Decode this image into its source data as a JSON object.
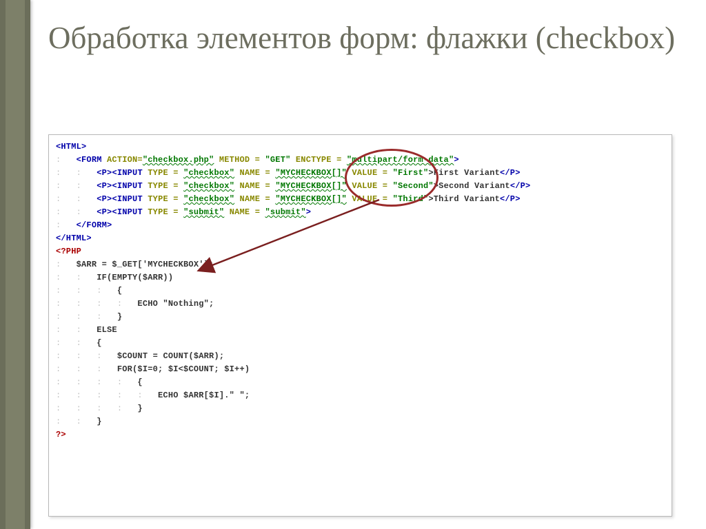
{
  "title": "Обработка элементов форм: флажки (checkbox)",
  "code": {
    "l1a": "<HTML>",
    "l2_open": "<FORM",
    "l2_attr": " ACTION=",
    "l2_v1": "\"checkbox.php\"",
    "l2_a2": " METHOD = ",
    "l2_v2": "\"GET\"",
    "l2_a3": " ENCTYPE = ",
    "l2_v3": "\"multipart/form-data\"",
    "l2_close": ">",
    "p_open": "<P>",
    "inp_open": "<INPUT",
    "type_a": " TYPE = ",
    "type_cb": "\"checkbox\"",
    "name_a": " NAME = ",
    "name_v": "\"MYCHECKBOX[]\"",
    "val_a": " VALUE = ",
    "val1": "\"First\"",
    "val2": "\"Second\"",
    "val3": "\"Third\"",
    "txt1": ">First Variant",
    "txt2": ">Second Variant",
    "txt3": ">Third Variant",
    "p_close": "</P>",
    "type_sub": "\"submit\"",
    "name_sub": "\"submit\"",
    "form_close": "</FORM>",
    "html_close": "</HTML>",
    "php_open": "<?PHP",
    "php1": "$ARR = $_GET['MYCHECKBOX'];",
    "php2": "IF(EMPTY($ARR))",
    "php3": "{",
    "php4": "ECHO \"Nothing\";",
    "php5": "}",
    "php6": "ELSE",
    "php7": "{",
    "php8": "$COUNT = COUNT($ARR);",
    "php9": "FOR($I=0; $I<$COUNT; $I++)",
    "php10": "{",
    "php11": "ECHO $ARR[$I].\" \";",
    "php12": "}",
    "php13": "}",
    "php_close": "?>"
  },
  "indent": {
    "i1": "    ",
    "i2": "        ",
    "i3": "            ",
    "i4": "                ",
    "i5": "                    ",
    "i6": "                        "
  },
  "guide": {
    "d1": ":   ",
    "d2": ":   :   ",
    "d3": ":   :   :   ",
    "d4": ":   :   :   :   ",
    "d5": ":   :   :   :   :   ",
    "d6": ":   :   :   :   :   :   "
  }
}
